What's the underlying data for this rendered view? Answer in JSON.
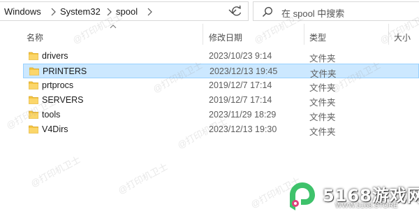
{
  "breadcrumb": [
    "Windows",
    "System32",
    "spool"
  ],
  "search": {
    "placeholder": "在 spool 中搜索"
  },
  "columns": {
    "name": "名称",
    "date": "修改日期",
    "type": "类型",
    "size": "大小"
  },
  "files": [
    {
      "name": "drivers",
      "date": "2023/10/23 9:14",
      "type": "文件夹",
      "selected": false
    },
    {
      "name": "PRINTERS",
      "date": "2023/12/13 19:45",
      "type": "文件夹",
      "selected": true
    },
    {
      "name": "prtprocs",
      "date": "2019/12/7 17:14",
      "type": "文件夹",
      "selected": false
    },
    {
      "name": "SERVERS",
      "date": "2019/12/7 17:14",
      "type": "文件夹",
      "selected": false
    },
    {
      "name": "tools",
      "date": "2023/11/29 18:29",
      "type": "文件夹",
      "selected": false
    },
    {
      "name": "V4Dirs",
      "date": "2023/12/13 19:30",
      "type": "文件夹",
      "selected": false
    }
  ],
  "watermark": {
    "text": "@打印机卫士"
  },
  "brand": {
    "title": "5168游戏网",
    "url": "WWW.5168.STORE"
  },
  "icons": {
    "folder": "folder-icon",
    "search": "search-icon",
    "refresh": "refresh-icon",
    "dropdown": "chevron-down-icon",
    "separator": "chevron-right-icon",
    "sort": "sort-up-icon"
  },
  "colors": {
    "selection": "#cce8ff",
    "selection_border": "#99d1ff",
    "folder": "#f5c542",
    "brand_green": "#3ec26b"
  }
}
